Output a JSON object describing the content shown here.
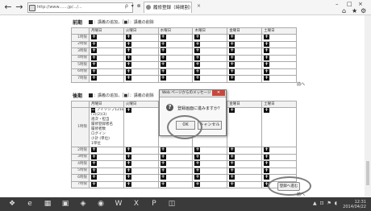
{
  "browser": {
    "back": "←",
    "forward": "→",
    "address": "http://www.......jp/.../...",
    "address_tools": "ρ ▾ ⊗ ↻",
    "tab_title": "履修登録（時間割）",
    "tab_close": "×",
    "minimize": "–",
    "maximize": "□",
    "close": "×",
    "home_icon": "⌂",
    "star_icon": "★",
    "gear_icon": "⚙"
  },
  "top_section": {
    "label": "前期",
    "legend": "：講義の追加，［■］：講義の削除",
    "legend_mark1": "■",
    "days": [
      "月曜日",
      "火曜日",
      "水曜日",
      "木曜日",
      "金曜日",
      "土曜日"
    ],
    "periods": [
      "1時限",
      "2時限",
      "3時限",
      "4時限",
      "5時限",
      "6時限",
      "7時限"
    ],
    "plus": "+",
    "footer": "前へ"
  },
  "bottom_section": {
    "label": "後期",
    "legend": "：講義の追加，［■］：講義の削除",
    "legend_mark1": "■",
    "days": [
      "月曜日",
      "火曜日",
      "水曜日",
      "木曜日",
      "金曜日",
      "土曜日"
    ],
    "periods": [
      "1時限",
      "2時限",
      "3時限",
      "4時限",
      "5時限",
      "6時限",
      "7時限"
    ],
    "plus": "+",
    "registered": {
      "mark": "−",
      "title": "アイソシブ121B",
      "lines": [
        "(1)(2)(3)",
        "週次・担当",
        "履修登録者名",
        "履修者数",
        "ログイン",
        "小計 (単位)",
        "1単位"
      ]
    },
    "confirm_button": "登録へ進む",
    "footer": "前へ"
  },
  "dialog": {
    "title": "Web ページからのメッセージ",
    "close": "✕",
    "question_icon": "?",
    "message": "登録画面に進みますか？",
    "ok": "OK",
    "cancel": "キャンセル"
  },
  "taskbar": {
    "items": [
      "❖",
      "e",
      "▦",
      "▣",
      "◈",
      "◉",
      "W",
      "X",
      "P",
      "◫"
    ],
    "tray_icons": "▲ ⊡ ⚑ ◖",
    "time": "12:31",
    "date": "2014/04/22"
  }
}
